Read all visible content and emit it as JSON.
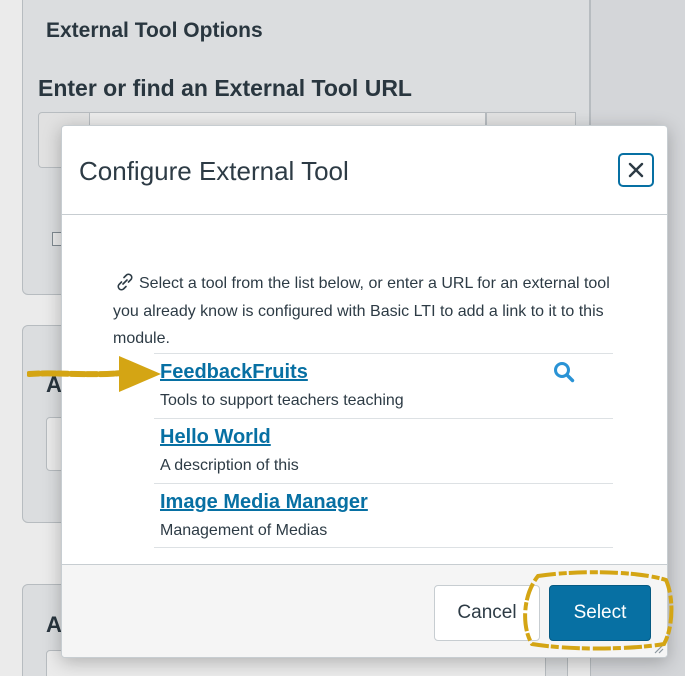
{
  "background": {
    "section_heading": "External Tool Options",
    "url_label": "Enter or find an External Tool URL",
    "panel2_heading_initial": "A",
    "panel3_heading_initial": "A"
  },
  "modal": {
    "title": "Configure External Tool",
    "close_icon": "close-icon",
    "intro_icon": "link-icon",
    "intro_text": "Select a tool from the list below, or enter a URL for an external tool you already know is configured with Basic LTI to add a link to it to this module.",
    "tools": [
      {
        "name": "FeedbackFruits",
        "description": "Tools to support teachers teaching",
        "icon": "search-icon"
      },
      {
        "name": "Hello World",
        "description": "A description of this"
      },
      {
        "name": "Image Media Manager",
        "description": "Management of Medias"
      }
    ],
    "footer": {
      "cancel_label": "Cancel",
      "select_label": "Select"
    }
  },
  "colors": {
    "accent": "#0770a3",
    "annotation": "#d4a514"
  }
}
